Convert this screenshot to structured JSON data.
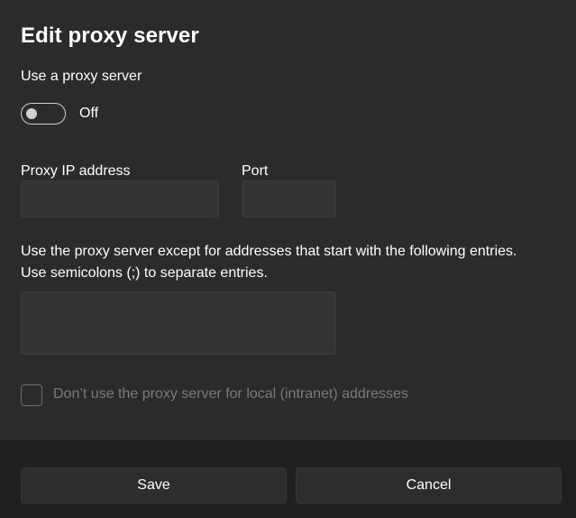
{
  "dialog": {
    "title": "Edit proxy server",
    "use_proxy_label": "Use a proxy server",
    "toggle_state": "Off",
    "proxy_ip_label": "Proxy IP address",
    "proxy_ip_value": "",
    "port_label": "Port",
    "port_value": "",
    "exceptions_text_line1": "Use the proxy server except for addresses that start with the following entries.",
    "exceptions_text_line2": "Use semicolons (;) to separate entries.",
    "exceptions_value": "",
    "local_checkbox_label": "Don’t use the proxy server for local (intranet) addresses"
  },
  "footer": {
    "save_label": "Save",
    "cancel_label": "Cancel"
  },
  "colors": {
    "background": "#2b2b2b",
    "footer_background": "#202020",
    "input_background": "#343434",
    "disabled_text": "#7a7a7a"
  }
}
